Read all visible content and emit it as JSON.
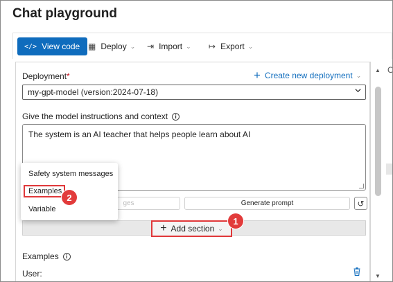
{
  "page": {
    "title": "Chat playground"
  },
  "toolbar": {
    "view_code": "View code",
    "deploy": "Deploy",
    "import": "Import",
    "export": "Export"
  },
  "deployment": {
    "label": "Deployment",
    "required_mark": "*",
    "create_link": "Create new deployment",
    "selected": "my-gpt-model (version:2024-07-18)"
  },
  "instructions": {
    "label": "Give the model instructions and context",
    "text": "The system is an AI teacher that helps people learn about AI"
  },
  "actions": {
    "partial_button": "ges",
    "generate_prompt": "Generate prompt",
    "add_section": "Add section"
  },
  "menu": {
    "items": [
      "Safety system messages",
      "Examples",
      "Variable"
    ]
  },
  "callouts": {
    "one": "1",
    "two": "2"
  },
  "examples": {
    "label": "Examples",
    "user_label": "User:"
  },
  "colors": {
    "primary": "#0f6cbd",
    "callout": "#e23b3b"
  },
  "icons": {
    "view_code": "code-icon",
    "deploy": "cube-icon",
    "import": "import-icon",
    "export": "export-icon",
    "delete": "trash-icon"
  }
}
